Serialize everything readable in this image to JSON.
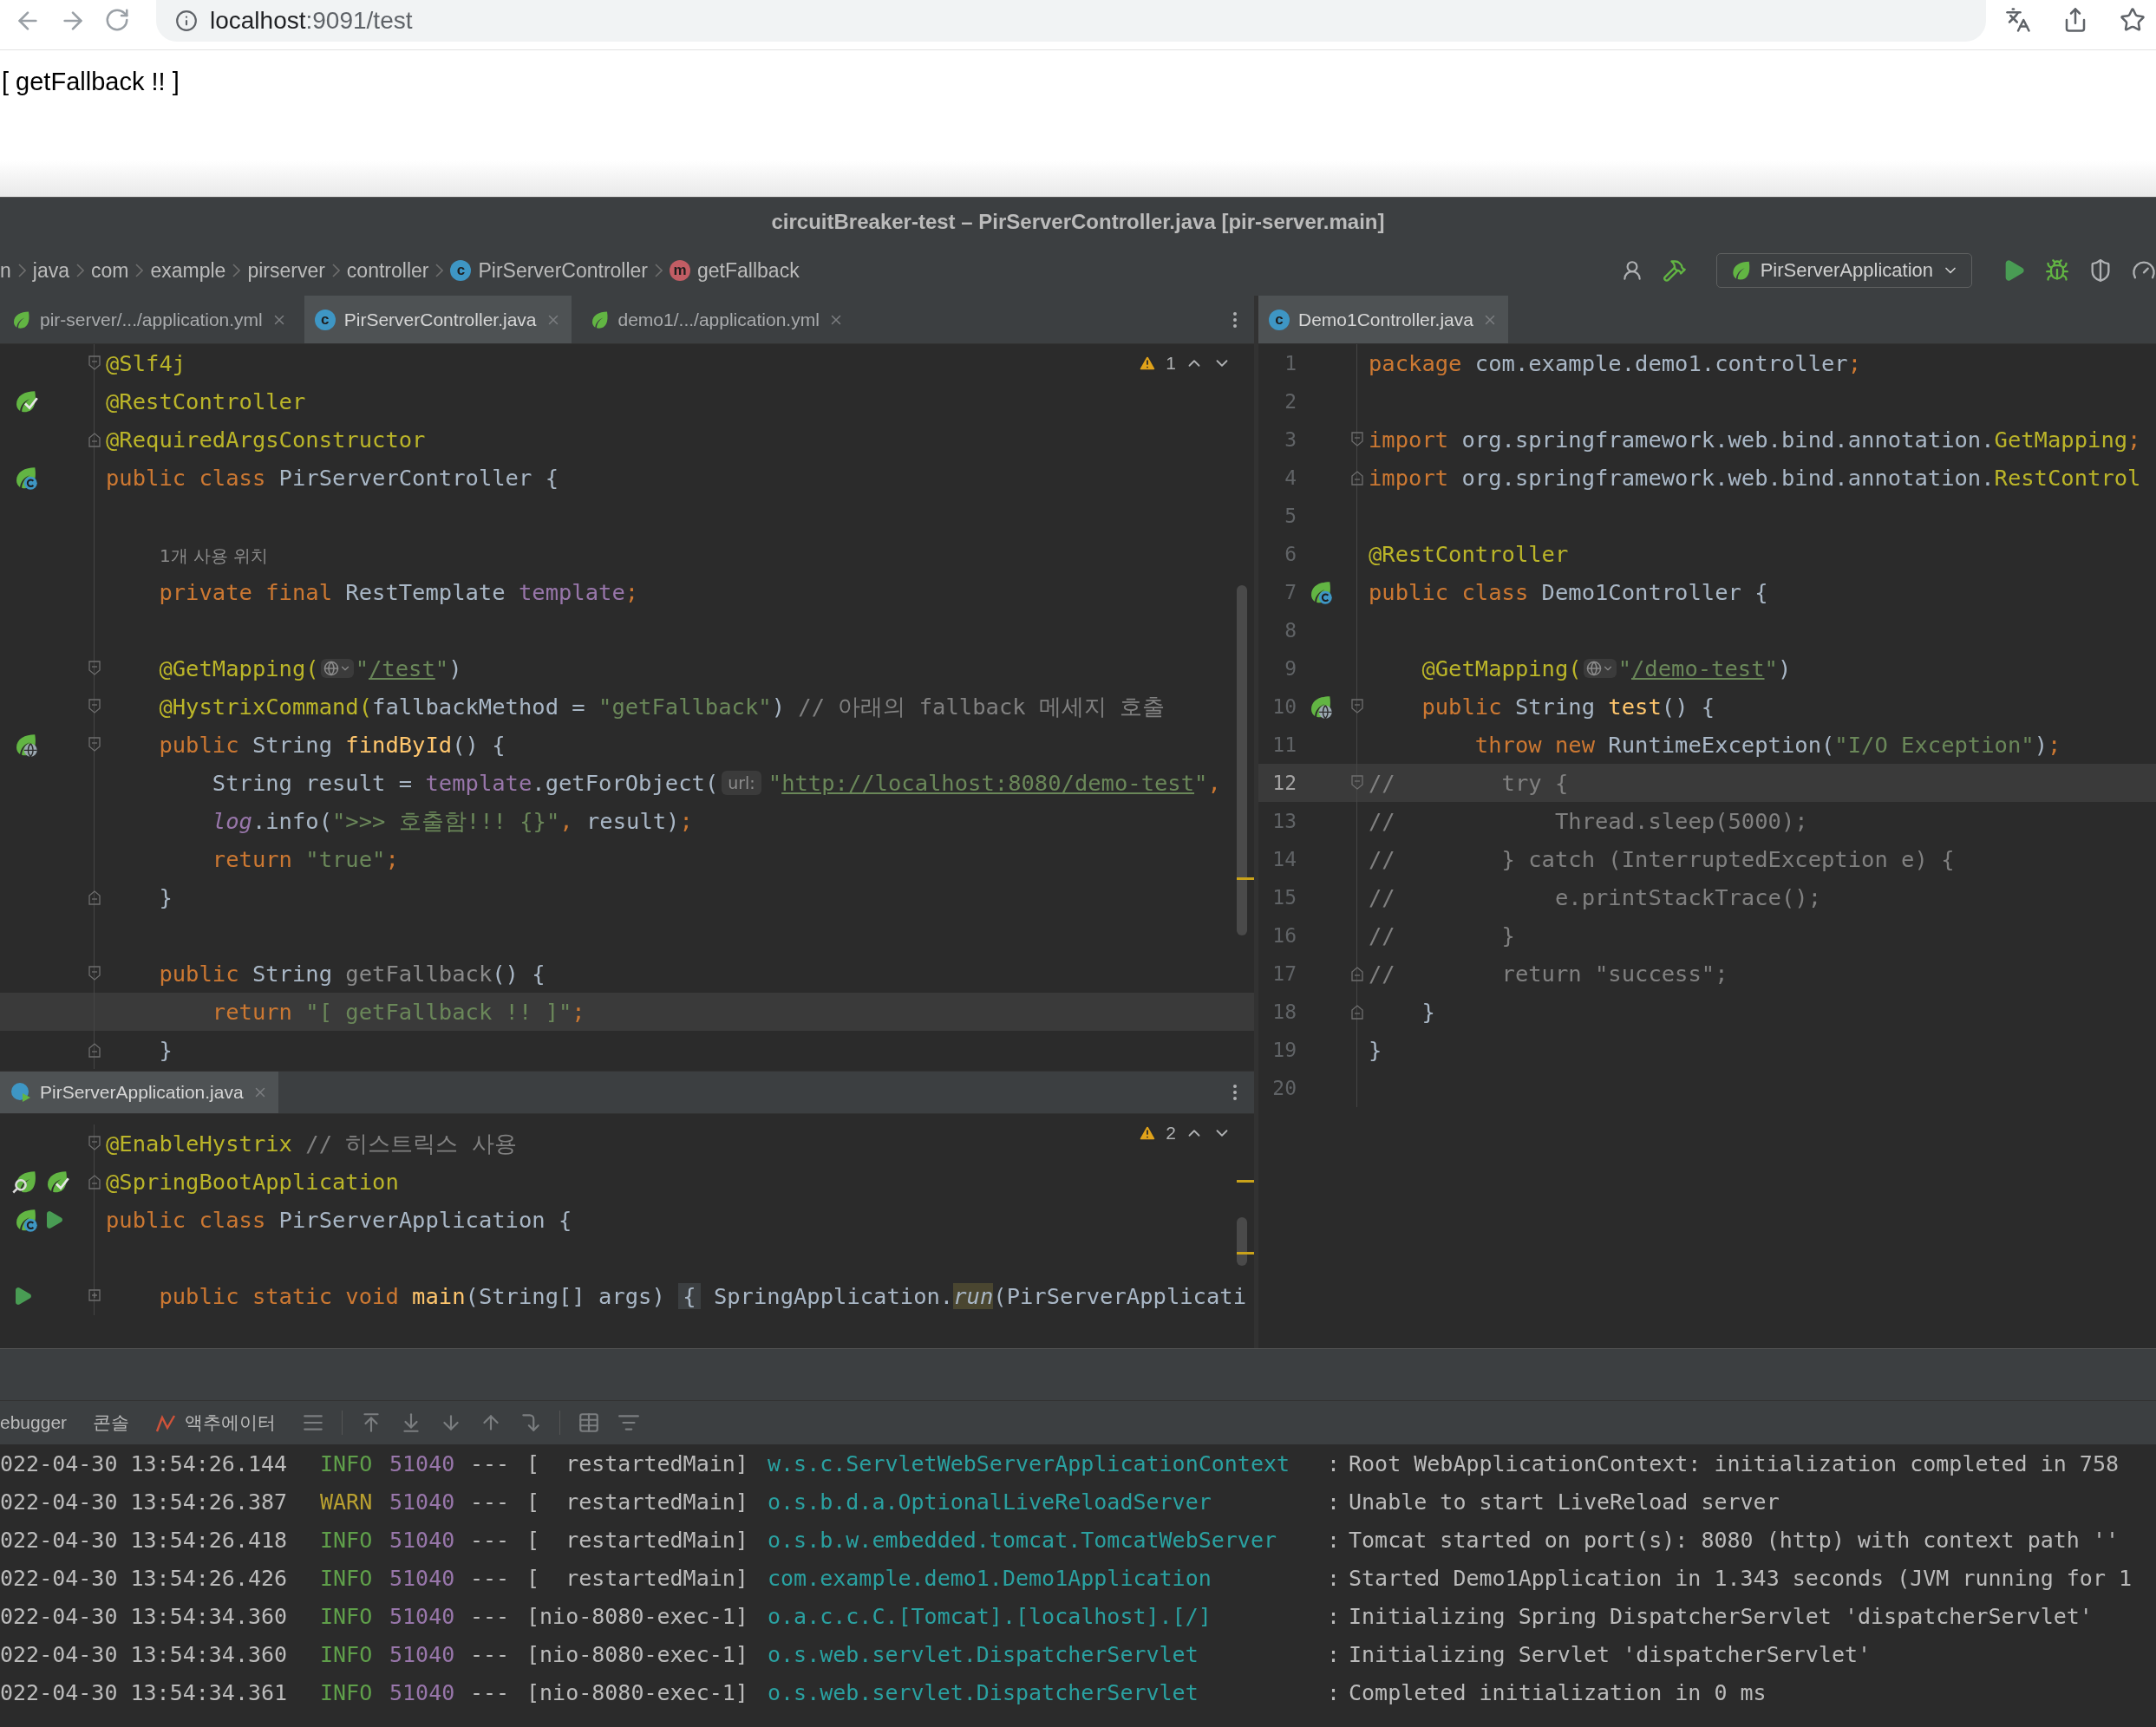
{
  "browser": {
    "url_host": "localhost",
    "url_rest": ":9091/test",
    "page_text": "[ getFallback !! ]"
  },
  "ide": {
    "title": "circuitBreaker-test – PirServerController.java [pir-server.main]",
    "breadcrumbs": [
      {
        "label": "n",
        "kind": "package"
      },
      {
        "label": "java",
        "kind": "package"
      },
      {
        "label": "com",
        "kind": "package"
      },
      {
        "label": "example",
        "kind": "package"
      },
      {
        "label": "pirserver",
        "kind": "package"
      },
      {
        "label": "controller",
        "kind": "package"
      },
      {
        "label": "PirServerController",
        "kind": "class",
        "badge": "c"
      },
      {
        "label": "getFallback",
        "kind": "method",
        "badge": "m"
      }
    ],
    "run_config": "PirServerApplication",
    "left_tabs": [
      {
        "label": "pir-server/.../application.yml",
        "kind": "yml",
        "selected": false
      },
      {
        "label": "PirServerController.java",
        "kind": "java",
        "badge": "c",
        "selected": true
      },
      {
        "label": "demo1/.../application.yml",
        "kind": "yml",
        "selected": false
      }
    ],
    "right_tabs": [
      {
        "label": "Demo1Controller.java",
        "kind": "java",
        "badge": "c",
        "selected": true
      }
    ],
    "editor_top": {
      "warnings": "1",
      "lines": [
        {
          "fold": {
            "kind": "start"
          },
          "current": false,
          "tokens": [
            {
              "kind": "ann",
              "text": "@Slf4j"
            }
          ]
        },
        {
          "gutter": [
            {
              "kind": "bean-check"
            }
          ],
          "current": false,
          "tokens": [
            {
              "kind": "ann",
              "text": "@RestController"
            }
          ]
        },
        {
          "fold": {
            "kind": "end"
          },
          "current": false,
          "tokens": [
            {
              "kind": "ann",
              "text": "@RequiredArgsConstructor"
            }
          ]
        },
        {
          "gutter": [
            {
              "kind": "bean-class"
            }
          ],
          "current": false,
          "tokens": [
            {
              "kind": "kw",
              "text": "public class "
            },
            {
              "kind": "p",
              "text": "PirServerController {"
            }
          ]
        },
        {
          "current": false
        },
        {
          "current": false,
          "tokens": [
            {
              "kind": "usage",
              "text": "1개 사용 위치"
            }
          ]
        },
        {
          "current": false,
          "tokens": [
            {
              "kind": "kw",
              "text": "    private final "
            },
            {
              "kind": "p",
              "text": "RestTemplate "
            },
            {
              "kind": "field",
              "text": "template"
            },
            {
              "kind": "kw",
              "text": ";"
            }
          ]
        },
        {
          "current": false
        },
        {
          "fold": {
            "kind": "start"
          },
          "current": false,
          "tokens": [
            {
              "kind": "ann",
              "text": "    @GetMapping("
            },
            {
              "kind": "globe"
            },
            {
              "kind": "str",
              "text": "\""
            },
            {
              "kind": "link",
              "text": "/test"
            },
            {
              "kind": "str",
              "text": "\""
            },
            {
              "kind": "p",
              "text": ")"
            }
          ]
        },
        {
          "fold": {
            "kind": "start"
          },
          "current": false,
          "tokens": [
            {
              "kind": "ann",
              "text": "    @HystrixCommand("
            },
            {
              "kind": "p",
              "text": "fallbackMethod = "
            },
            {
              "kind": "str",
              "text": "\"getFallback\""
            },
            {
              "kind": "p",
              "text": ")"
            },
            {
              "kind": "cmt",
              "text": " // 아래의 fallback 메세지 호출"
            }
          ]
        },
        {
          "gutter": [
            {
              "kind": "bean-web"
            }
          ],
          "fold": {
            "kind": "start"
          },
          "current": false,
          "tokens": [
            {
              "kind": "kw",
              "text": "    public "
            },
            {
              "kind": "p",
              "text": "String "
            },
            {
              "kind": "fn",
              "text": "findById"
            },
            {
              "kind": "p",
              "text": "() {"
            }
          ]
        },
        {
          "current": false,
          "tokens": [
            {
              "kind": "p",
              "text": "        String result = "
            },
            {
              "kind": "field",
              "text": "template"
            },
            {
              "kind": "p",
              "text": ".getForObject("
            },
            {
              "kind": "hint",
              "text": "url:"
            },
            {
              "kind": "str",
              "text": "\""
            },
            {
              "kind": "link",
              "text": "http://localhost:8080/demo-test"
            },
            {
              "kind": "str",
              "text": "\""
            },
            {
              "kind": "kw",
              "text": ","
            }
          ]
        },
        {
          "current": false,
          "tokens": [
            {
              "kind": "static",
              "text": "        log"
            },
            {
              "kind": "p",
              "text": ".info("
            },
            {
              "kind": "str",
              "text": "\">>> 호출함!!! {}\""
            },
            {
              "kind": "kw",
              "text": ", "
            },
            {
              "kind": "p",
              "text": "result)"
            },
            {
              "kind": "kw",
              "text": ";"
            }
          ]
        },
        {
          "current": false,
          "tokens": [
            {
              "kind": "kw",
              "text": "        return "
            },
            {
              "kind": "str",
              "text": "\"true\""
            },
            {
              "kind": "kw",
              "text": ";"
            }
          ]
        },
        {
          "fold": {
            "kind": "end"
          },
          "current": false,
          "tokens": [
            {
              "kind": "p",
              "text": "    }"
            }
          ]
        },
        {
          "current": false
        },
        {
          "fold": {
            "kind": "start"
          },
          "current": false,
          "tokens": [
            {
              "kind": "kw",
              "text": "    public "
            },
            {
              "kind": "p",
              "text": "String "
            },
            {
              "kind": "dim",
              "text": "getFallback"
            },
            {
              "kind": "p",
              "text": "() {"
            }
          ]
        },
        {
          "current": true,
          "tokens": [
            {
              "kind": "kw",
              "text": "        return "
            },
            {
              "kind": "str",
              "text": "\"[ getFallback !! ]\""
            },
            {
              "kind": "kw",
              "text": ";"
            }
          ]
        },
        {
          "fold": {
            "kind": "end"
          },
          "current": false,
          "tokens": [
            {
              "kind": "p",
              "text": "    }"
            }
          ]
        }
      ]
    },
    "split_tabs": [
      {
        "label": "PirServerApplication.java",
        "kind": "java-app",
        "selected": true
      }
    ],
    "editor_bottom": {
      "warnings": "2",
      "lines": [
        {
          "fold": {
            "kind": "start"
          },
          "current": false,
          "tokens": [
            {
              "kind": "ann",
              "text": "@EnableHystrix"
            },
            {
              "kind": "cmt",
              "text": " // 히스트릭스 사용"
            }
          ]
        },
        {
          "gutter": [
            {
              "kind": "search-bean"
            },
            {
              "kind": "bean-check"
            }
          ],
          "fold": {
            "kind": "end"
          },
          "current": false,
          "tokens": [
            {
              "kind": "ann",
              "text": "@SpringBootApplication"
            }
          ]
        },
        {
          "gutter": [
            {
              "kind": "bean-class"
            },
            {
              "kind": "run"
            }
          ],
          "current": false,
          "tokens": [
            {
              "kind": "kw",
              "text": "public class "
            },
            {
              "kind": "p",
              "text": "PirServerApplication {"
            }
          ]
        },
        {
          "current": false
        },
        {
          "gutter": [
            {
              "kind": "run"
            }
          ],
          "fold": {
            "kind": "collapsed"
          },
          "current": false,
          "tokens": [
            {
              "kind": "kw",
              "text": "    public static void "
            },
            {
              "kind": "fn",
              "text": "main"
            },
            {
              "kind": "p",
              "text": "(String[] args) "
            },
            {
              "kind": "folded",
              "text": "{"
            },
            {
              "kind": "p",
              "text": " SpringApplication."
            },
            {
              "kind": "run",
              "text": "run"
            },
            {
              "kind": "p",
              "text": "(PirServerApplicati"
            }
          ]
        }
      ]
    },
    "editor_right": {
      "lines": [
        {
          "no": "1",
          "current": false,
          "tokens": [
            {
              "kind": "kw",
              "text": "package "
            },
            {
              "kind": "p",
              "text": "com.example.demo1.controller"
            },
            {
              "kind": "kw",
              "text": ";"
            }
          ]
        },
        {
          "no": "2",
          "current": false
        },
        {
          "no": "3",
          "fold": {
            "kind": "start"
          },
          "current": false,
          "tokens": [
            {
              "kind": "kw",
              "text": "import "
            },
            {
              "kind": "p",
              "text": "org.springframework.web.bind.annotation."
            },
            {
              "kind": "ann",
              "text": "GetMapping"
            },
            {
              "kind": "kw",
              "text": ";"
            }
          ]
        },
        {
          "no": "4",
          "fold": {
            "kind": "end"
          },
          "current": false,
          "tokens": [
            {
              "kind": "kw",
              "text": "import "
            },
            {
              "kind": "p",
              "text": "org.springframework.web.bind.annotation."
            },
            {
              "kind": "ann",
              "text": "RestControl"
            }
          ]
        },
        {
          "no": "5",
          "current": false
        },
        {
          "no": "6",
          "current": false,
          "tokens": [
            {
              "kind": "ann",
              "text": "@RestController"
            }
          ]
        },
        {
          "no": "7",
          "gutter": [
            {
              "kind": "bean-class"
            }
          ],
          "current": false,
          "tokens": [
            {
              "kind": "kw",
              "text": "public class "
            },
            {
              "kind": "p",
              "text": "Demo1Controller {"
            }
          ]
        },
        {
          "no": "8",
          "current": false
        },
        {
          "no": "9",
          "current": false,
          "tokens": [
            {
              "kind": "ann",
              "text": "    @GetMapping("
            },
            {
              "kind": "globe"
            },
            {
              "kind": "str",
              "text": "\""
            },
            {
              "kind": "link",
              "text": "/demo-test"
            },
            {
              "kind": "str",
              "text": "\""
            },
            {
              "kind": "p",
              "text": ")"
            }
          ]
        },
        {
          "no": "10",
          "gutter": [
            {
              "kind": "bean-web"
            }
          ],
          "fold": {
            "kind": "start"
          },
          "current": false,
          "tokens": [
            {
              "kind": "kw",
              "text": "    public "
            },
            {
              "kind": "p",
              "text": "String "
            },
            {
              "kind": "fn",
              "text": "test"
            },
            {
              "kind": "p",
              "text": "() {"
            }
          ]
        },
        {
          "no": "11",
          "current": false,
          "tokens": [
            {
              "kind": "kw",
              "text": "        throw new "
            },
            {
              "kind": "p",
              "text": "RuntimeException("
            },
            {
              "kind": "str",
              "text": "\"I/O Exception\""
            },
            {
              "kind": "p",
              "text": ")"
            },
            {
              "kind": "kw",
              "text": ";"
            }
          ]
        },
        {
          "no": "12",
          "fold": {
            "kind": "start"
          },
          "current": true,
          "tokens": [
            {
              "kind": "cmt",
              "text": "//        try {"
            }
          ]
        },
        {
          "no": "13",
          "current": false,
          "tokens": [
            {
              "kind": "cmt",
              "text": "//            Thread.sleep(5000);"
            }
          ]
        },
        {
          "no": "14",
          "current": false,
          "tokens": [
            {
              "kind": "cmt",
              "text": "//        } catch (InterruptedException e) {"
            }
          ]
        },
        {
          "no": "15",
          "current": false,
          "tokens": [
            {
              "kind": "cmt",
              "text": "//            e.printStackTrace();"
            }
          ]
        },
        {
          "no": "16",
          "current": false,
          "tokens": [
            {
              "kind": "cmt",
              "text": "//        }"
            }
          ]
        },
        {
          "no": "17",
          "fold": {
            "kind": "end"
          },
          "current": false,
          "tokens": [
            {
              "kind": "cmt",
              "text": "//        return \"success\";"
            }
          ]
        },
        {
          "no": "18",
          "fold": {
            "kind": "end"
          },
          "current": false,
          "tokens": [
            {
              "kind": "p",
              "text": "    }"
            }
          ]
        },
        {
          "no": "19",
          "current": false,
          "tokens": [
            {
              "kind": "p",
              "text": "}"
            }
          ]
        },
        {
          "no": "20",
          "current": false
        }
      ]
    },
    "debug_tabs": [
      {
        "label": "ebugger",
        "kind": "plain"
      },
      {
        "label": "콘솔",
        "kind": "plain"
      },
      {
        "label": "액추에이터",
        "kind": "graph"
      }
    ],
    "console": {
      "lines": [
        {
          "timestamp": "022-04-30 13:54:26.144",
          "level": "INFO",
          "kind": "info",
          "pid": "51040",
          "dashes": "---",
          "thread": "[  restartedMain]",
          "logger": "w.s.c.ServletWebServerApplicationContext",
          "colon": ":",
          "message": "Root WebApplicationContext: initialization completed in 758"
        },
        {
          "timestamp": "022-04-30 13:54:26.387",
          "level": "WARN",
          "kind": "warn",
          "pid": "51040",
          "dashes": "---",
          "thread": "[  restartedMain]",
          "logger": "o.s.b.d.a.OptionalLiveReloadServer",
          "colon": ":",
          "message": "Unable to start LiveReload server"
        },
        {
          "timestamp": "022-04-30 13:54:26.418",
          "level": "INFO",
          "kind": "info",
          "pid": "51040",
          "dashes": "---",
          "thread": "[  restartedMain]",
          "logger": "o.s.b.w.embedded.tomcat.TomcatWebServer",
          "colon": ":",
          "message": "Tomcat started on port(s): 8080 (http) with context path ''"
        },
        {
          "timestamp": "022-04-30 13:54:26.426",
          "level": "INFO",
          "kind": "info",
          "pid": "51040",
          "dashes": "---",
          "thread": "[  restartedMain]",
          "logger": "com.example.demo1.Demo1Application",
          "colon": ":",
          "message": "Started Demo1Application in 1.343 seconds (JVM running for 1"
        },
        {
          "timestamp": "022-04-30 13:54:34.360",
          "level": "INFO",
          "kind": "info",
          "pid": "51040",
          "dashes": "---",
          "thread": "[nio-8080-exec-1]",
          "logger": "o.a.c.c.C.[Tomcat].[localhost].[/]",
          "colon": ":",
          "message": "Initializing Spring DispatcherServlet 'dispatcherServlet'"
        },
        {
          "timestamp": "022-04-30 13:54:34.360",
          "level": "INFO",
          "kind": "info",
          "pid": "51040",
          "dashes": "---",
          "thread": "[nio-8080-exec-1]",
          "logger": "o.s.web.servlet.DispatcherServlet",
          "colon": ":",
          "message": "Initializing Servlet 'dispatcherServlet'"
        },
        {
          "timestamp": "022-04-30 13:54:34.361",
          "level": "INFO",
          "kind": "info",
          "pid": "51040",
          "dashes": "---",
          "thread": "[nio-8080-exec-1]",
          "logger": "o.s.web.servlet.DispatcherServlet",
          "colon": ":",
          "message": "Completed initialization in 0 ms"
        }
      ]
    }
  }
}
